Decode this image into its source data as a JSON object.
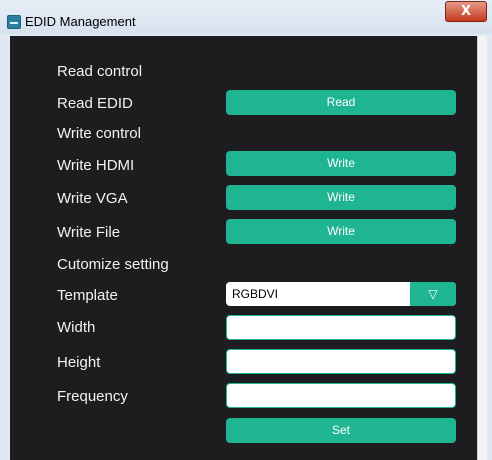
{
  "window": {
    "title": "EDID Management",
    "close_label": "X"
  },
  "sections": {
    "read_control": "Read control",
    "write_control": "Write control",
    "custom_setting": "Cutomize setting"
  },
  "rows": {
    "read_edid": {
      "label": "Read EDID",
      "button": "Read"
    },
    "write_hdmi": {
      "label": "Write HDMI",
      "button": "Write"
    },
    "write_vga": {
      "label": "Write VGA",
      "button": "Write"
    },
    "write_file": {
      "label": "Write File",
      "button": "Write"
    },
    "template": {
      "label": "Template",
      "value": "RGBDVI",
      "arrow": "▽"
    },
    "width": {
      "label": "Width",
      "value": ""
    },
    "height": {
      "label": "Height",
      "value": ""
    },
    "frequency": {
      "label": "Frequency",
      "value": ""
    }
  },
  "set_button": "Set",
  "colors": {
    "accent": "#1fb593",
    "panel": "#1d1d1f",
    "text": "#f2f2f2"
  },
  "icons": {
    "app": "edid-app-icon",
    "close": "close-icon",
    "dropdown": "chevron-down-icon"
  }
}
